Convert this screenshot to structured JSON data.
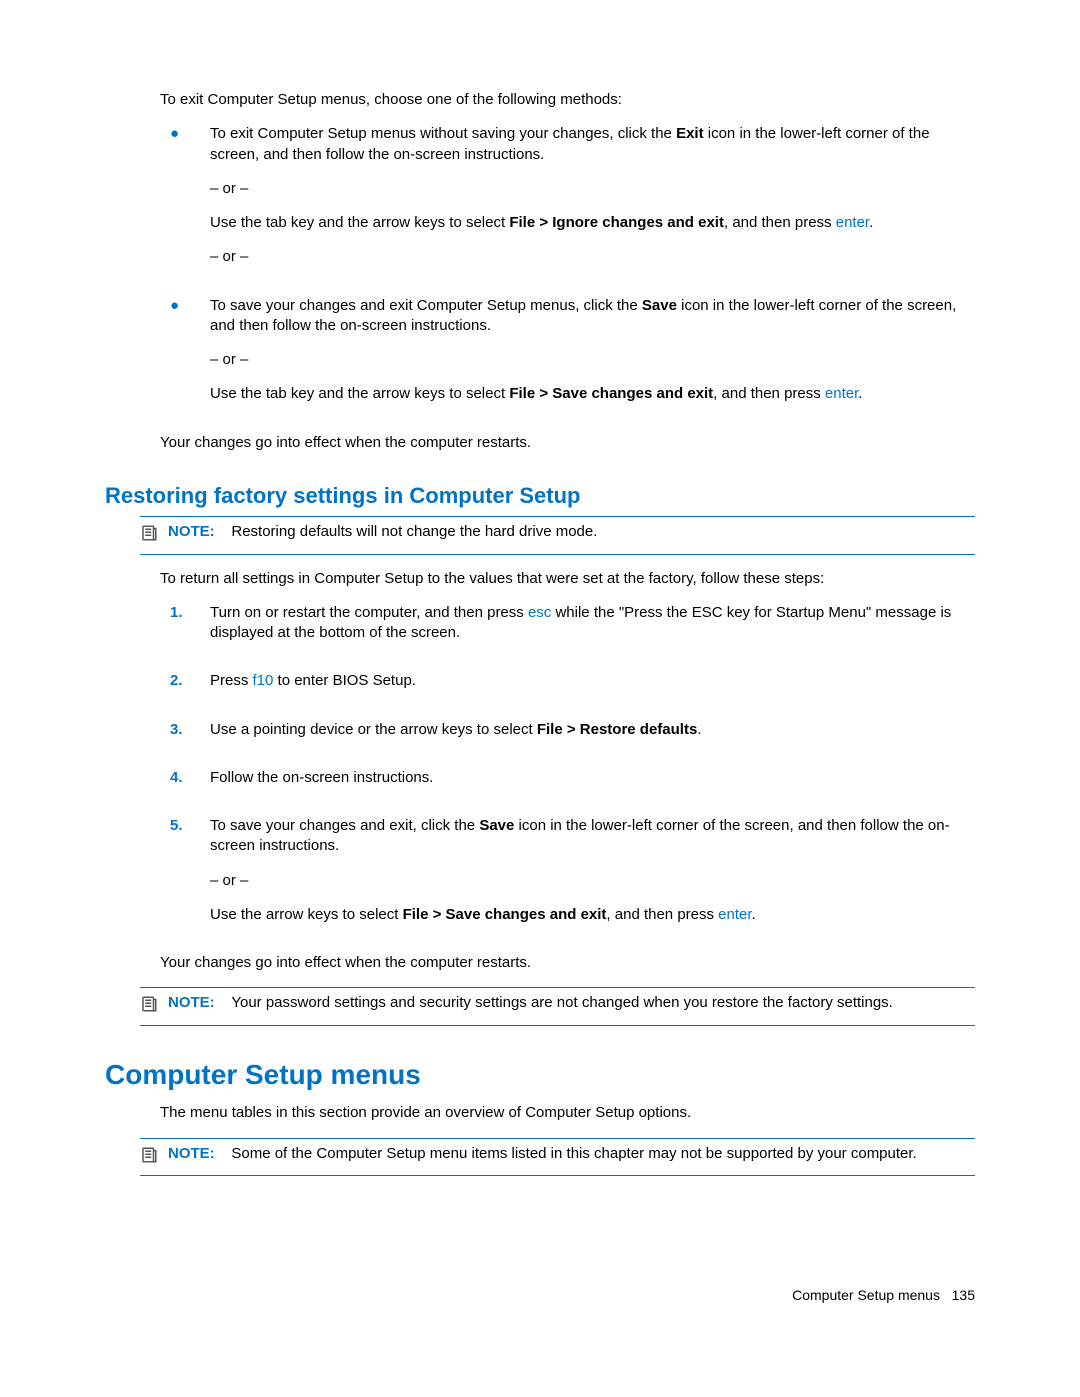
{
  "intro": "To exit Computer Setup menus, choose one of the following methods:",
  "bullets": [
    {
      "parts": [
        {
          "type": "text",
          "runs": [
            {
              "t": "To exit Computer Setup menus without saving your changes, click the "
            },
            {
              "t": "Exit",
              "b": true
            },
            {
              "t": " icon in the lower-left corner of the screen, and then follow the on-screen instructions."
            }
          ]
        },
        {
          "type": "or",
          "text": "– or –"
        },
        {
          "type": "text",
          "runs": [
            {
              "t": "Use the tab key and the arrow keys to select "
            },
            {
              "t": "File > Ignore changes and exit",
              "b": true
            },
            {
              "t": ", and then press "
            },
            {
              "t": "enter",
              "link": true
            },
            {
              "t": "."
            }
          ]
        },
        {
          "type": "or",
          "text": "– or –"
        }
      ]
    },
    {
      "parts": [
        {
          "type": "text",
          "runs": [
            {
              "t": "To save your changes and exit Computer Setup menus, click the "
            },
            {
              "t": "Save",
              "b": true
            },
            {
              "t": " icon in the lower-left corner of the screen, and then follow the on-screen instructions."
            }
          ]
        },
        {
          "type": "or",
          "text": "– or –"
        },
        {
          "type": "text",
          "runs": [
            {
              "t": "Use the tab key and the arrow keys to select "
            },
            {
              "t": "File > Save changes and exit",
              "b": true
            },
            {
              "t": ", and then press "
            },
            {
              "t": "enter",
              "link": true
            },
            {
              "t": "."
            }
          ]
        }
      ]
    }
  ],
  "after_bullets": "Your changes go into effect when the computer restarts.",
  "h2": "Restoring factory settings in Computer Setup",
  "note1_label": "NOTE:",
  "note1_text": "Restoring defaults will not change the hard drive mode.",
  "restore_intro": "To return all settings in Computer Setup to the values that were set at the factory, follow these steps:",
  "steps": [
    {
      "n": "1.",
      "parts": [
        {
          "type": "text",
          "runs": [
            {
              "t": "Turn on or restart the computer, and then press "
            },
            {
              "t": "esc",
              "link": true
            },
            {
              "t": " while the \"Press the ESC key for Startup Menu\" message is displayed at the bottom of the screen."
            }
          ]
        }
      ]
    },
    {
      "n": "2.",
      "parts": [
        {
          "type": "text",
          "runs": [
            {
              "t": "Press "
            },
            {
              "t": "f10",
              "link": true
            },
            {
              "t": " to enter BIOS Setup."
            }
          ]
        }
      ]
    },
    {
      "n": "3.",
      "parts": [
        {
          "type": "text",
          "runs": [
            {
              "t": "Use a pointing device or the arrow keys to select "
            },
            {
              "t": "File > Restore defaults",
              "b": true
            },
            {
              "t": "."
            }
          ]
        }
      ]
    },
    {
      "n": "4.",
      "parts": [
        {
          "type": "text",
          "runs": [
            {
              "t": "Follow the on-screen instructions."
            }
          ]
        }
      ]
    },
    {
      "n": "5.",
      "parts": [
        {
          "type": "text",
          "runs": [
            {
              "t": "To save your changes and exit, click the "
            },
            {
              "t": "Save",
              "b": true
            },
            {
              "t": " icon in the lower-left corner of the screen, and then follow the on-screen instructions."
            }
          ]
        },
        {
          "type": "or",
          "text": "– or –"
        },
        {
          "type": "text",
          "runs": [
            {
              "t": "Use the arrow keys to select "
            },
            {
              "t": "File > Save changes and exit",
              "b": true
            },
            {
              "t": ", and then press "
            },
            {
              "t": "enter",
              "link": true
            },
            {
              "t": "."
            }
          ]
        }
      ]
    }
  ],
  "after_steps": "Your changes go into effect when the computer restarts.",
  "note2_label": "NOTE:",
  "note2_text": "Your password settings and security settings are not changed when you restore the factory settings.",
  "h1": "Computer Setup menus",
  "menus_intro": "The menu tables in this section provide an overview of Computer Setup options.",
  "note3_label": "NOTE:",
  "note3_text": "Some of the Computer Setup menu items listed in this chapter may not be supported by your computer.",
  "footer_title": "Computer Setup menus",
  "footer_page": "135"
}
